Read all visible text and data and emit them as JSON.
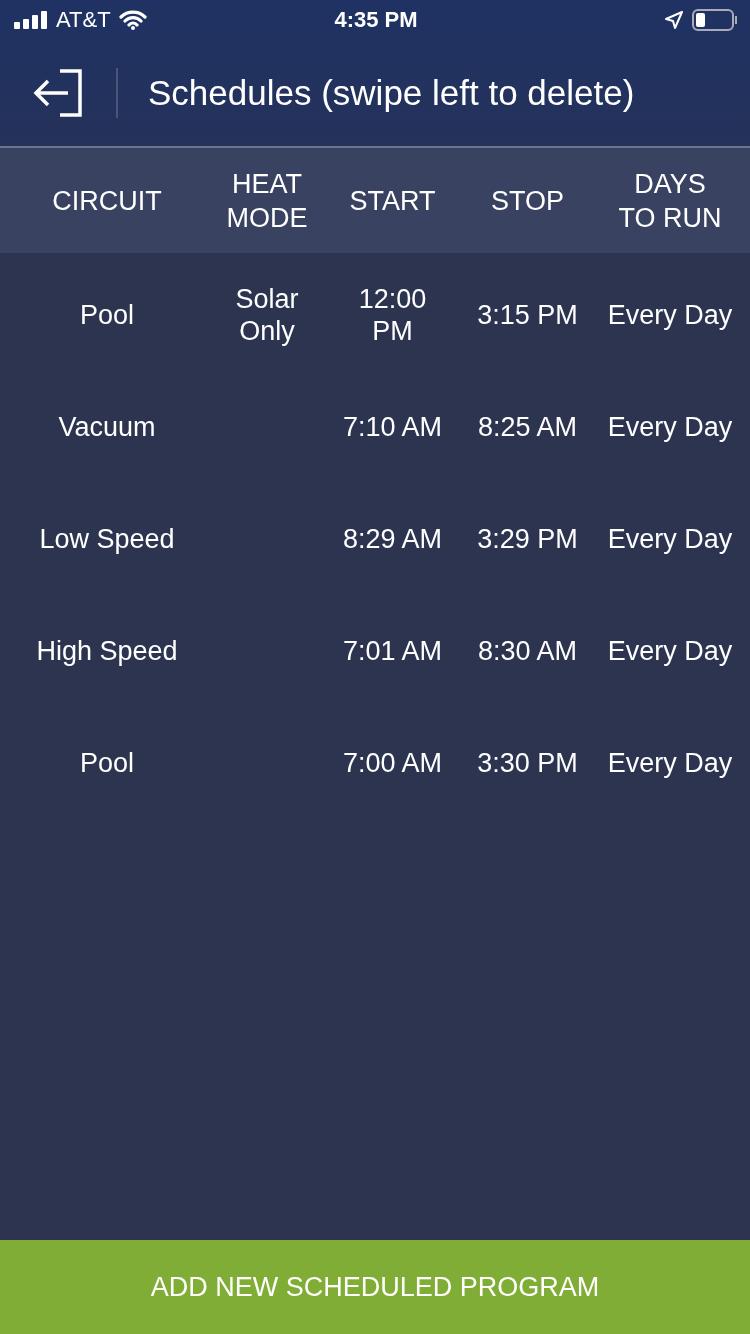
{
  "status_bar": {
    "carrier": "AT&T",
    "time": "4:35 PM"
  },
  "nav": {
    "title": "Schedules (swipe left to delete)"
  },
  "table": {
    "columns": [
      "CIRCUIT",
      "HEAT\nMODE",
      "START",
      "STOP",
      "DAYS\nTO RUN"
    ],
    "rows": [
      {
        "circuit": "Pool",
        "heat_mode": "Solar\nOnly",
        "start": "12:00\nPM",
        "stop": "3:15 PM",
        "days": "Every Day"
      },
      {
        "circuit": "Vacuum",
        "start": "7:10 AM",
        "stop": "8:25 AM",
        "days": "Every Day"
      },
      {
        "circuit": "Low Speed",
        "start": "8:29 AM",
        "stop": "3:29 PM",
        "days": "Every Day"
      },
      {
        "circuit": "High Speed",
        "start": "7:01 AM",
        "stop": "8:30 AM",
        "days": "Every Day"
      },
      {
        "circuit": "Pool",
        "start": "7:00 AM",
        "stop": "3:30 PM",
        "days": "Every Day"
      }
    ]
  },
  "footer_button": "ADD NEW SCHEDULED PROGRAM"
}
